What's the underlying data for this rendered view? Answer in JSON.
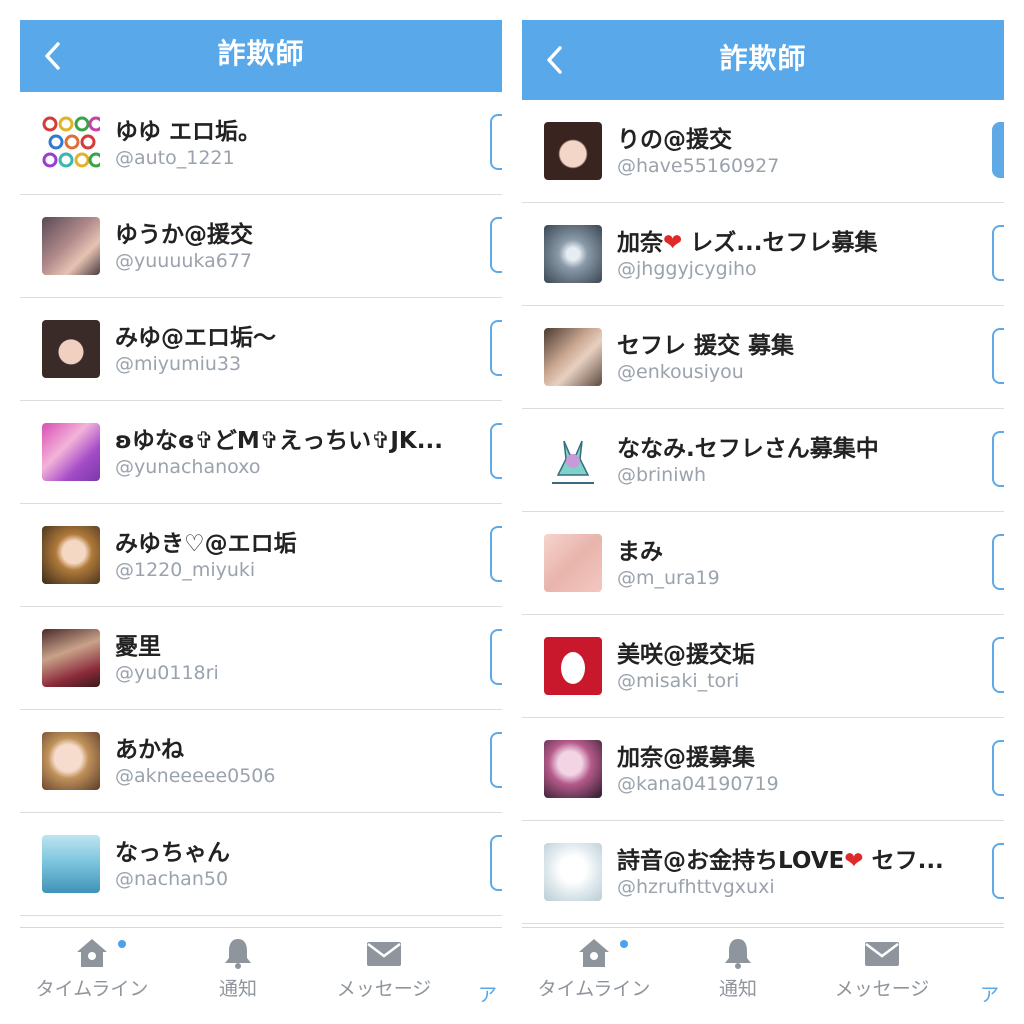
{
  "colors": {
    "header": "#58a8ea",
    "accent": "#5ea9e6",
    "handle": "#9aa3ad",
    "tab": "#8e959c"
  },
  "panels": [
    {
      "title": "詐欺師",
      "users": [
        {
          "name": "ゆゆ エロ垢。",
          "handle": "@auto_1221"
        },
        {
          "name": "ゆうか@援交",
          "handle": "@yuuuuka677"
        },
        {
          "name": "みゆ@エロ垢〜",
          "handle": "@miyumiu33"
        },
        {
          "name": "ʚゆなɞ✞どM✞えっちい✞JK...",
          "handle": "@yunachanoxo"
        },
        {
          "name": "みゆき♡@エロ垢",
          "handle": "@1220_miyuki"
        },
        {
          "name": "憂里",
          "handle": "@yu0118ri"
        },
        {
          "name": "あかね",
          "handle": "@akneeeee0506"
        },
        {
          "name": "なっちゃん",
          "handle": "@nachan50"
        }
      ],
      "tabs": {
        "timeline": "タイムライン",
        "notifications": "通知",
        "messages": "メッセージ",
        "clipped": "ア"
      }
    },
    {
      "title": "詐欺師",
      "users": [
        {
          "name": "りの@援交",
          "handle": "@have55160927"
        },
        {
          "name_a": "加奈",
          "heart": "❤",
          "name_b": " レズ...セフレ募集",
          "handle": "@jhggyjcygiho"
        },
        {
          "name": "セフレ 援交 募集",
          "handle": "@enkousiyou"
        },
        {
          "name": "ななみ.セフレさん募集中",
          "handle": "@briniwh"
        },
        {
          "name": "まみ",
          "handle": "@m_ura19"
        },
        {
          "name": "美咲@援交垢",
          "handle": "@misaki_tori"
        },
        {
          "name": "加奈@援募集",
          "handle": "@kana04190719"
        },
        {
          "name_a": "詩音@お金持ちLOVE",
          "heart": "❤",
          "name_b": " セフ...",
          "handle": "@hzrufhttvgxuxi"
        }
      ],
      "tabs": {
        "timeline": "タイムライン",
        "notifications": "通知",
        "messages": "メッセージ",
        "clipped": "ア"
      }
    }
  ]
}
